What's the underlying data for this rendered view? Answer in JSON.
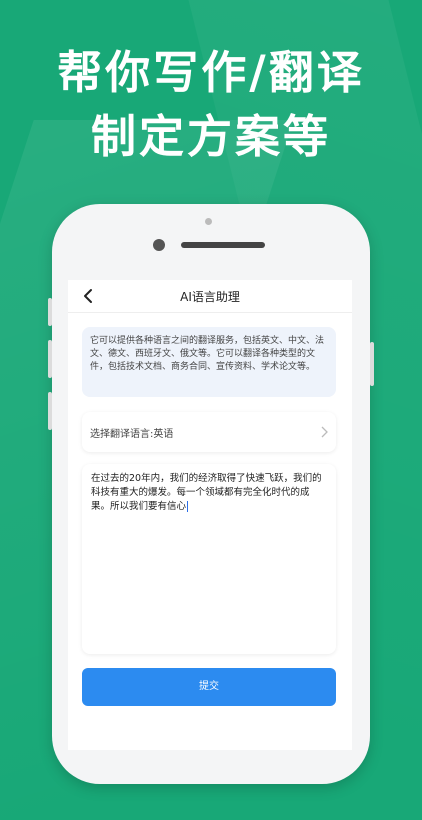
{
  "headline": {
    "line1": "帮你写作/翻译",
    "line2": "制定方案等"
  },
  "app": {
    "title": "AI语言助理"
  },
  "info_text": "它可以提供各种语言之间的翻译服务，包括英文、中文、法文、德文、西班牙文、俄文等。它可以翻译各种类型的文件，包括技术文档、商务合同、宣传资料、学术论文等。",
  "language_select": {
    "label": "选择翻译语言:英语"
  },
  "input": {
    "value": "在过去的20年内，我们的经济取得了快速飞跃，我们的科技有重大的爆发。每一个领域都有完全化时代的成果。所以我们要有信心"
  },
  "submit_label": "提交",
  "colors": {
    "background": "#18a877",
    "accent": "#2c8bf0",
    "info_bg": "#eef3fb"
  }
}
